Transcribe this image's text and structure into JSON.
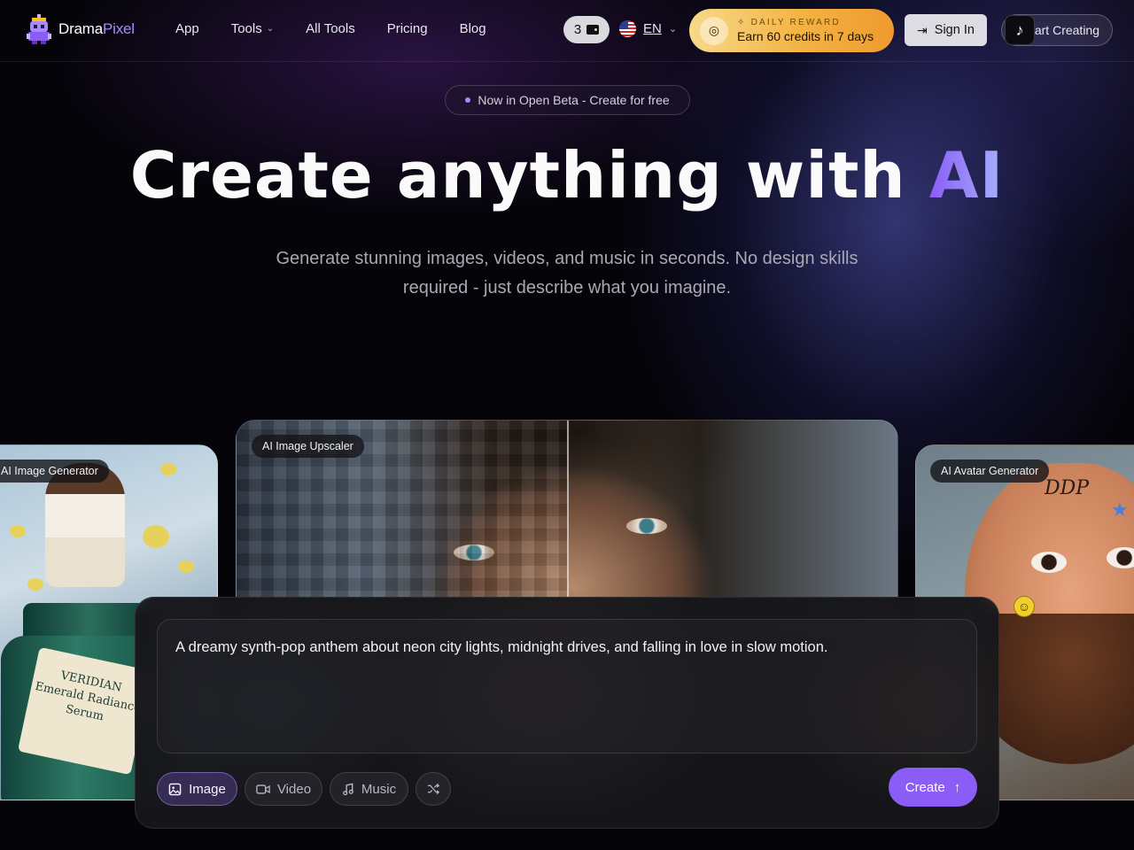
{
  "brand": {
    "name_main": "Drama",
    "name_accent": "Pixel"
  },
  "nav": {
    "links": [
      {
        "label": "App"
      },
      {
        "label": "Tools",
        "has_dropdown": true
      },
      {
        "label": "All Tools"
      },
      {
        "label": "Pricing"
      },
      {
        "label": "Blog"
      }
    ],
    "credits": "3",
    "language": "EN",
    "reward": {
      "label": "DAILY REWARD",
      "text": "Earn 60 credits in 7 days"
    },
    "sign_in": "Sign In",
    "start_creating": "Start Creating"
  },
  "hero": {
    "badge": "Now in Open Beta - Create for free",
    "headline_main": "Create anything with",
    "headline_accent": "AI",
    "subheadline": "Generate stunning images, videos, and music in seconds. No design skills required - just describe what you imagine."
  },
  "showcase": {
    "left_tag": "AI Image Generator",
    "center_tag": "AI Image Upscaler",
    "right_tag": "AI Avatar Generator",
    "jar_label": "VERIDIAN Emerald Radiance Serum",
    "avatar_forehead_text": "DDP"
  },
  "prompt": {
    "text": "A dreamy synth-pop anthem about neon city lights, midnight drives, and falling in love in slow motion.",
    "modes": [
      {
        "label": "Image",
        "icon": "image-icon",
        "active": true
      },
      {
        "label": "Video",
        "icon": "video-icon",
        "active": false
      },
      {
        "label": "Music",
        "icon": "music-icon",
        "active": false
      }
    ],
    "create": "Create"
  },
  "colors": {
    "accent": "#8b5cf6",
    "reward_gold": "#f3b342",
    "background": "#050409"
  }
}
